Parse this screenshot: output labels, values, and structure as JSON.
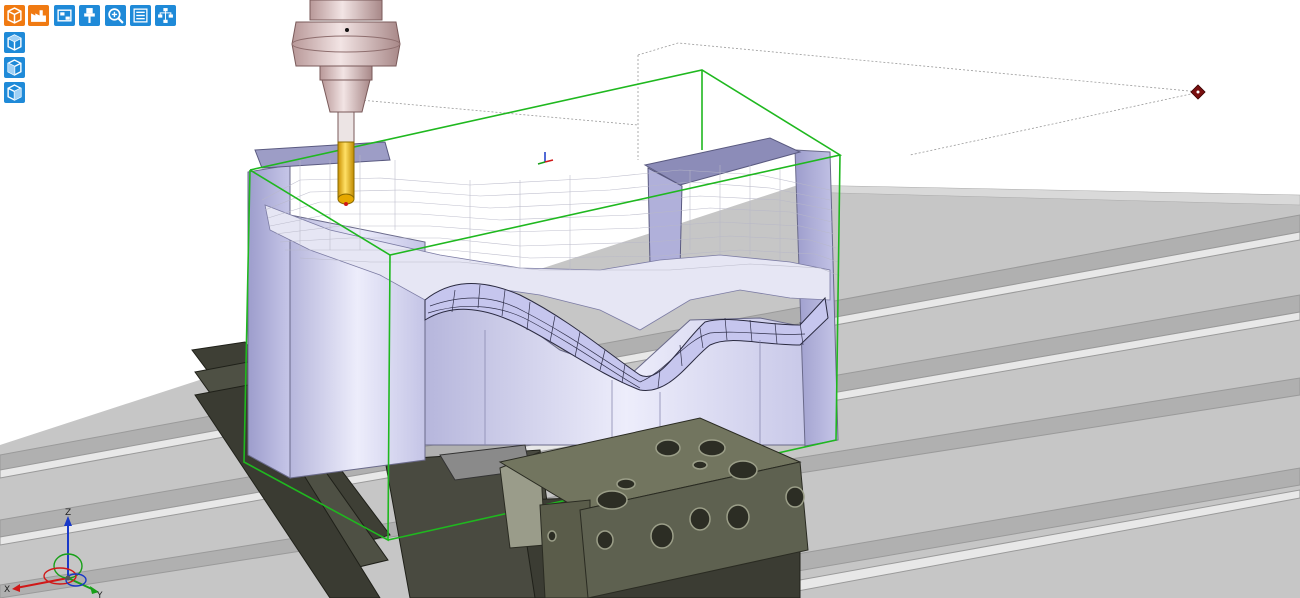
{
  "toolbar": {
    "row1": [
      {
        "icon": "stock-cube-icon",
        "color": "#f07a12"
      },
      {
        "icon": "factory-icon",
        "color": "#f07a12"
      },
      {
        "icon": "machine-icon",
        "color": "#1f8ad8"
      },
      {
        "icon": "tool-holder-icon",
        "color": "#1f8ad8"
      },
      {
        "icon": "zoom-icon",
        "color": "#1f8ad8"
      },
      {
        "icon": "list-icon",
        "color": "#1f8ad8"
      },
      {
        "icon": "tree-icon",
        "color": "#1f8ad8"
      }
    ],
    "column": [
      {
        "icon": "view-iso-icon",
        "color": "#1f8ad8"
      },
      {
        "icon": "view-front-icon",
        "color": "#1f8ad8"
      },
      {
        "icon": "view-side-icon",
        "color": "#1f8ad8"
      }
    ]
  },
  "triad": {
    "x_label": "X",
    "y_label": "Y",
    "z_label": "Z",
    "x_color": "#d01818",
    "y_color": "#18a018",
    "z_color": "#1838c8"
  },
  "scene": {
    "stock_outline_color": "#22bb22",
    "part_color": "#c8c8ec",
    "vise_color": "#5e6150",
    "tool_color": "#e8b800",
    "table_color": "#c9c9c9"
  }
}
